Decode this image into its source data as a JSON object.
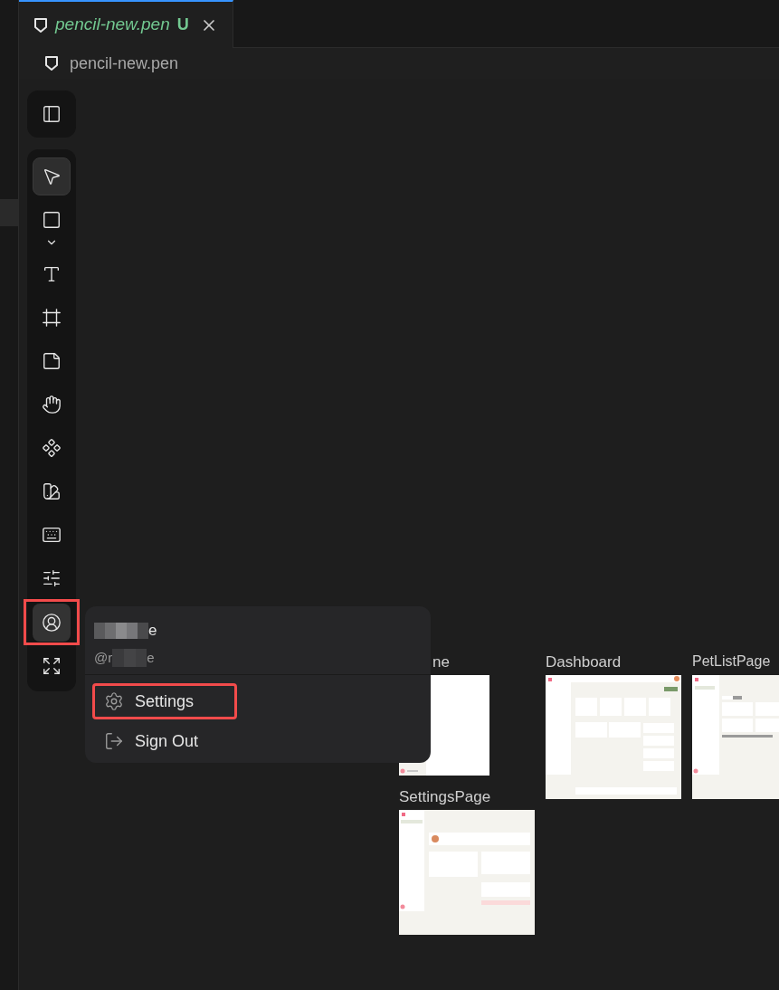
{
  "tabs": [
    {
      "label": "pencil-new.pen",
      "status": "U",
      "selected": true,
      "untracked": true
    }
  ],
  "breadcrumb": {
    "label": "pencil-new.pen"
  },
  "toolbar": {
    "panel_toggle": {
      "selected": false
    },
    "items": [
      {
        "kind": "select",
        "selected": true,
        "highlighted": false
      },
      {
        "kind": "rectangle",
        "selected": false,
        "highlighted": false
      },
      {
        "kind": "text",
        "selected": false,
        "highlighted": false
      },
      {
        "kind": "frame",
        "selected": false,
        "highlighted": false
      },
      {
        "kind": "note",
        "selected": false,
        "highlighted": false
      },
      {
        "kind": "hand",
        "selected": false,
        "highlighted": false
      },
      {
        "kind": "component",
        "selected": false,
        "highlighted": false
      },
      {
        "kind": "swatches",
        "selected": false,
        "highlighted": false
      },
      {
        "kind": "keyboard",
        "selected": false,
        "highlighted": false
      },
      {
        "kind": "sliders",
        "selected": false,
        "highlighted": false
      },
      {
        "kind": "user",
        "selected": true,
        "highlighted": true
      },
      {
        "kind": "fullscreen",
        "selected": false,
        "highlighted": false
      }
    ]
  },
  "user_menu": {
    "name_tail": "e",
    "handle_head": "@r",
    "handle_tail": "e",
    "items": [
      {
        "kind": "settings",
        "label": "Settings",
        "highlighted": true
      },
      {
        "kind": "sign-out",
        "label": "Sign Out",
        "highlighted": false
      }
    ]
  },
  "canvas": {
    "frames": [
      {
        "label": "ne",
        "kind": "blank"
      },
      {
        "label": "Dashboard",
        "kind": "dashboard"
      },
      {
        "label": "PetListPage",
        "kind": "list"
      },
      {
        "label": "SettingsPage",
        "kind": "settings"
      }
    ]
  }
}
